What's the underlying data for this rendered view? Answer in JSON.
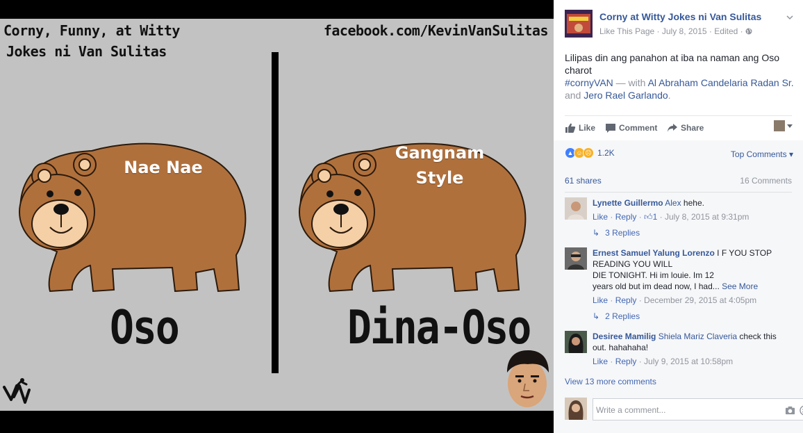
{
  "photo": {
    "top_left_line1": "Corny, Funny, at Witty",
    "top_left_line2": "Jokes ni Van Sulitas",
    "top_right": "facebook.com/KevinVanSulitas",
    "bear_left_label": "Nae Nae",
    "bear_right_label_line1": "Gangnam",
    "bear_right_label_line2": "Style",
    "word_left": "Oso",
    "word_right": "Dina-Oso",
    "bear_color": "#b0703c",
    "bg_color": "#c2c2c2"
  },
  "post": {
    "page_name": "Corny at Witty Jokes ni Van Sulitas",
    "like_this_page": "Like This Page",
    "date": "July 8, 2015",
    "edited": "Edited",
    "meta_sep": "·",
    "text_line": "Lilipas din ang panahon at iba na naman ang Oso charot",
    "hashtag": "#cornyVAN",
    "with_text": " — with ",
    "tag1": "Al Abraham Candelaria Radan Sr.",
    "and_text": " and ",
    "tag2": "Jero Rael Garlando",
    "period": "."
  },
  "actions": {
    "like": "Like",
    "comment": "Comment",
    "share": "Share"
  },
  "stats": {
    "reaction_count": "1.2K",
    "top_comments": "Top Comments",
    "shares": "61 shares",
    "comments": "16 Comments"
  },
  "comments": [
    {
      "name": "Lynette Guillermo",
      "tag": "Alex",
      "text": " hehe.",
      "like": "Like",
      "reply": "Reply",
      "likes": "1",
      "time": "July 8, 2015 at 9:31pm",
      "replies": "3 Replies"
    },
    {
      "name": "Ernest Samuel Yalung Lorenzo",
      "text_line1": " I F YOU STOP READING YOU WILL",
      "text_line2": "DIE TONIGHT. Hi im louie. Im 12",
      "text_line3": "years old but im dead now, I had...",
      "see_more": "See More",
      "like": "Like",
      "reply": "Reply",
      "time": "December 29, 2015 at 4:05pm",
      "replies": "2 Replies"
    },
    {
      "name": "Desiree Mamilig",
      "tag": "Shiela Mariz Claveria",
      "text": " check this out. hahahaha!",
      "like": "Like",
      "reply": "Reply",
      "time": "July 9, 2015 at 10:58pm"
    }
  ],
  "view_more": "View 13 more comments",
  "composer": {
    "placeholder": "Write a comment..."
  }
}
